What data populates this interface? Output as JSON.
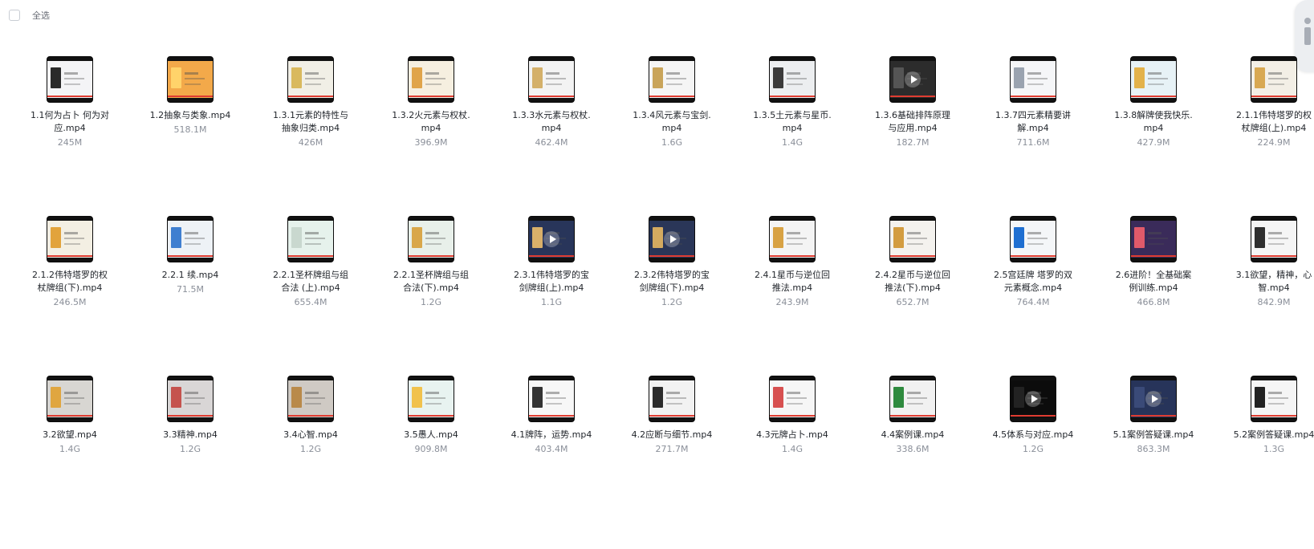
{
  "toolbar": {
    "select_all_label": "全选"
  },
  "files": [
    {
      "name": "1.1何为占卜 何为对应.mp4",
      "size": "245M",
      "bg": "#f4f4f6",
      "accent": "#2a2a2a"
    },
    {
      "name": "1.2抽象与类象.mp4",
      "size": "518.1M",
      "bg": "#f3a94a",
      "accent": "#ffd36a"
    },
    {
      "name": "1.3.1元素的特性与抽象归类.mp4",
      "size": "426M",
      "bg": "#f1efe6",
      "accent": "#d9b95e"
    },
    {
      "name": "1.3.2火元素与权杖.mp4",
      "size": "396.9M",
      "bg": "#f6efe0",
      "accent": "#e0a44a"
    },
    {
      "name": "1.3.3水元素与权杖.mp4",
      "size": "462.4M",
      "bg": "#f3f3f3",
      "accent": "#d4b06a"
    },
    {
      "name": "1.3.4风元素与宝剑.mp4",
      "size": "1.6G",
      "bg": "#f5f5f5",
      "accent": "#c9a45a"
    },
    {
      "name": "1.3.5土元素与星币.mp4",
      "size": "1.4G",
      "bg": "#eceef0",
      "accent": "#3b3b3b"
    },
    {
      "name": "1.3.6基础排阵原理与应用.mp4",
      "size": "182.7M",
      "bg": "#2c2c2c",
      "accent": "#555555",
      "play": true
    },
    {
      "name": "1.3.7四元素精要讲解.mp4",
      "size": "711.6M",
      "bg": "#f5f6f8",
      "accent": "#9aa3b0"
    },
    {
      "name": "1.3.8解牌使我快乐.mp4",
      "size": "427.9M",
      "bg": "#e7f2f6",
      "accent": "#e3b24a"
    },
    {
      "name": "2.1.1伟特塔罗的权杖牌组(上).mp4",
      "size": "224.9M",
      "bg": "#f3efe6",
      "accent": "#d8a852"
    },
    {
      "name": "2.1.2伟特塔罗的权杖牌组(下).mp4",
      "size": "246.5M",
      "bg": "#f3efe3",
      "accent": "#e2a33c"
    },
    {
      "name": "2.2.1 续.mp4",
      "size": "71.5M",
      "bg": "#eef2f6",
      "accent": "#3f7fd0"
    },
    {
      "name": "2.2.1圣杯牌组与组合法 (上).mp4",
      "size": "655.4M",
      "bg": "#e6f2ec",
      "accent": "#c9d8cf"
    },
    {
      "name": "2.2.1圣杯牌组与组合法(下).mp4",
      "size": "1.2G",
      "bg": "#e8f0ea",
      "accent": "#d9a74a"
    },
    {
      "name": "2.3.1伟特塔罗的宝剑牌组(上).mp4",
      "size": "1.1G",
      "bg": "#28355a",
      "accent": "#d9b06a",
      "play": true
    },
    {
      "name": "2.3.2伟特塔罗的宝剑牌组(下).mp4",
      "size": "1.2G",
      "bg": "#2a3658",
      "accent": "#d4aa60",
      "play": true
    },
    {
      "name": "2.4.1星币与逆位回推法.mp4",
      "size": "243.9M",
      "bg": "#f4f4f4",
      "accent": "#d8a244"
    },
    {
      "name": "2.4.2星币与逆位回推法(下).mp4",
      "size": "652.7M",
      "bg": "#f4f2ee",
      "accent": "#d39c40"
    },
    {
      "name": "2.5宫廷牌 塔罗的双元素概念.mp4",
      "size": "764.4M",
      "bg": "#f4f6f8",
      "accent": "#1f6fd1"
    },
    {
      "name": "2.6进阶！全基础案例训练.mp4",
      "size": "466.8M",
      "bg": "#3a2b5a",
      "accent": "#e05a6a"
    },
    {
      "name": "3.1欲望，精神，心智.mp4",
      "size": "842.9M",
      "bg": "#f5f5f5",
      "accent": "#2f2f2f"
    },
    {
      "name": "3.2欲望.mp4",
      "size": "1.4G",
      "bg": "#d8d6d2",
      "accent": "#e0a640"
    },
    {
      "name": "3.3精神.mp4",
      "size": "1.2G",
      "bg": "#d9d6d6",
      "accent": "#c5534e"
    },
    {
      "name": "3.4心智.mp4",
      "size": "1.2G",
      "bg": "#cfcac4",
      "accent": "#b98a4a"
    },
    {
      "name": "3.5愚人.mp4",
      "size": "909.8M",
      "bg": "#e8f3f0",
      "accent": "#f1c24c"
    },
    {
      "name": "4.1牌阵，运势.mp4",
      "size": "403.4M",
      "bg": "#f7f7f7",
      "accent": "#333333"
    },
    {
      "name": "4.2应断与细节.mp4",
      "size": "271.7M",
      "bg": "#f2f2f2",
      "accent": "#2b2b2b"
    },
    {
      "name": "4.3元牌占卜.mp4",
      "size": "1.4G",
      "bg": "#f6f6f6",
      "accent": "#d75050"
    },
    {
      "name": "4.4案例课.mp4",
      "size": "338.6M",
      "bg": "#f1f1f1",
      "accent": "#2e8a3e"
    },
    {
      "name": "4.5体系与对应.mp4",
      "size": "1.2G",
      "bg": "#0c0c0c",
      "accent": "#222222",
      "play": true
    },
    {
      "name": "5.1案例答疑课.mp4",
      "size": "863.3M",
      "bg": "#27345a",
      "accent": "#3a4a78",
      "play": true
    },
    {
      "name": "5.2案例答疑课.mp4",
      "size": "1.3G",
      "bg": "#f5f5f5",
      "accent": "#222222"
    }
  ]
}
